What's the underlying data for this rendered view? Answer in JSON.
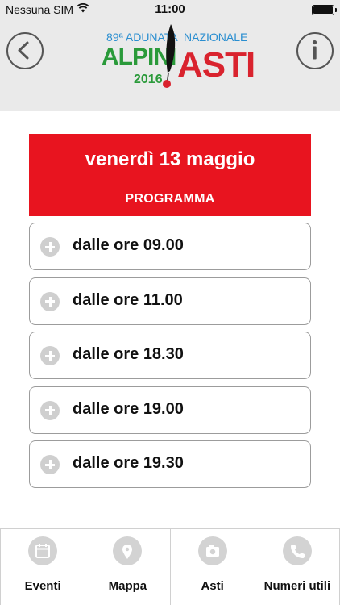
{
  "status_bar": {
    "carrier": "Nessuna SIM",
    "time": "11:00"
  },
  "header": {
    "logo": {
      "top_left": "89ª ADUNATA",
      "top_right": "NAZIONALE",
      "word_left": "ALPINI",
      "year": "2016",
      "word_right": "ASTI"
    },
    "back_icon": "chevron-left-icon",
    "info_icon": "info-icon"
  },
  "banner": {
    "date": "venerdì 13 maggio",
    "subtitle": "PROGRAMMA",
    "color": "#e8141f"
  },
  "schedule": [
    {
      "label": "dalle ore 09.00"
    },
    {
      "label": "dalle ore 11.00"
    },
    {
      "label": "dalle ore 18.30"
    },
    {
      "label": "dalle ore 19.00"
    },
    {
      "label": "dalle ore 19.30"
    }
  ],
  "tabs": [
    {
      "label": "Eventi",
      "icon": "calendar-icon"
    },
    {
      "label": "Mappa",
      "icon": "map-pin-icon"
    },
    {
      "label": "Asti",
      "icon": "camera-icon"
    },
    {
      "label": "Numeri utili",
      "icon": "phone-icon"
    }
  ]
}
